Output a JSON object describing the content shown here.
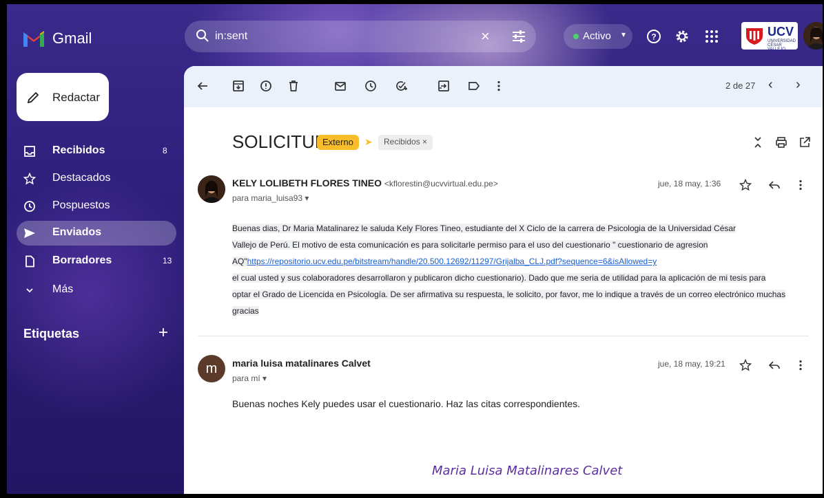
{
  "app": {
    "name": "Gmail"
  },
  "search": {
    "value": "in:sent"
  },
  "status": {
    "label": "Activo"
  },
  "account": {
    "org_logo_text": "UCV",
    "org_logo_subtext": "UNIVERSIDAD CÉSAR VALLEJO"
  },
  "compose": {
    "label": "Redactar"
  },
  "sidebar": {
    "items": [
      {
        "label": "Recibidos",
        "count": "8",
        "bold": true
      },
      {
        "label": "Destacados",
        "count": "",
        "bold": false
      },
      {
        "label": "Pospuestos",
        "count": "",
        "bold": false
      },
      {
        "label": "Enviados",
        "count": "",
        "bold": true
      },
      {
        "label": "Borradores",
        "count": "13",
        "bold": true
      },
      {
        "label": "Más",
        "count": "",
        "bold": false
      }
    ],
    "labels_heading": "Etiquetas"
  },
  "toolbar": {
    "pager": "2 de 27"
  },
  "thread": {
    "subject": "SOLICITUD",
    "chip_external": "Externo",
    "chip_inbox": "Recibidos ×"
  },
  "messages": [
    {
      "sender": "KELY LOLIBETH FLORES TINEO",
      "email": "<kfloresti​n@ucvvirtual.edu.pe>",
      "to": "para maria_luisa93 ▾",
      "date": "jue, 18 may, 1:36",
      "body_1": "Buenas dias, Dr Maria Matalinarez le saluda  Kely Flores Tineo, estudiante del X Ciclo de la carrera de Psicologia de la Universidad César",
      "body_2": "Vallejo de Perú. El motivo de esta comunicación es para solicitarle permiso para el uso del cuestionario  \" cuestionario de agresion",
      "body_3_prefix": "AQ\"",
      "body_3_link": "https://repositorio.ucv.edu.pe/bitstream/handle/20.500.12692/11297/Grijalba_CLJ.pdf?sequence=6&isAllowed=y",
      "body_4": "el cual  usted  y  sus  colaboradores  desarrollaron  y  publicaron  dicho cuestionario). Dado que me seria de utilidad para la aplicación de mi tesis para",
      "body_5": "optar el Grado de Licencida en Psicología. De ser afirmativa su respuesta, le solicito, por favor, me lo indique a través de un correo electrónico muchas",
      "body_6": "gracias"
    },
    {
      "avatar_letter": "m",
      "sender": "maria luisa matalinares Calvet",
      "to": "para mí ▾",
      "date": "jue, 18 may, 19:21",
      "body": "Buenas noches Kely puedes usar el cuestionario. Haz las citas correspondientes.",
      "signature": "Maria Luisa Matalinares Calvet"
    }
  ],
  "icons": {
    "brand_colors": [
      "#ea4335",
      "#4285f4",
      "#34a853",
      "#fbbc04"
    ],
    "accent": "#f8bd2a",
    "active_dot": "#48d36b"
  }
}
